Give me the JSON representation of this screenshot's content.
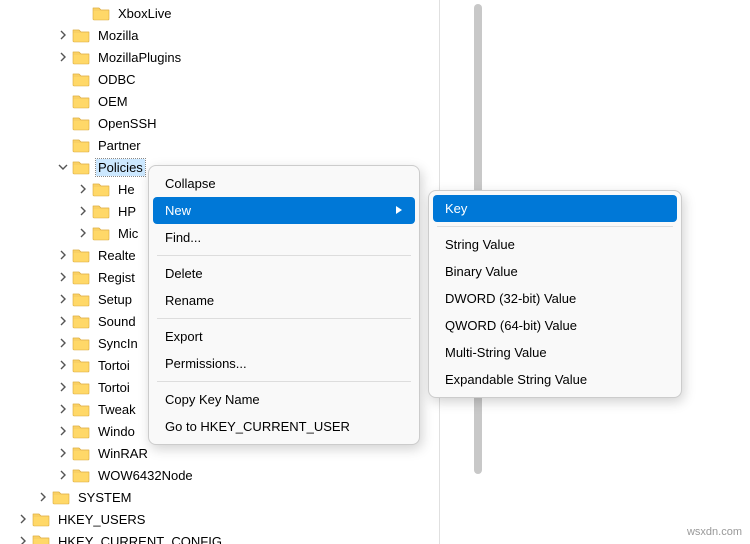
{
  "tree": [
    {
      "indent": 76,
      "chev": "",
      "label": "XboxLive"
    },
    {
      "indent": 56,
      "chev": "right",
      "label": "Mozilla"
    },
    {
      "indent": 56,
      "chev": "right",
      "label": "MozillaPlugins"
    },
    {
      "indent": 56,
      "chev": "",
      "label": "ODBC"
    },
    {
      "indent": 56,
      "chev": "",
      "label": "OEM"
    },
    {
      "indent": 56,
      "chev": "",
      "label": "OpenSSH"
    },
    {
      "indent": 56,
      "chev": "",
      "label": "Partner"
    },
    {
      "indent": 56,
      "chev": "down",
      "label": "Policies",
      "selected": true
    },
    {
      "indent": 76,
      "chev": "right",
      "label": "He"
    },
    {
      "indent": 76,
      "chev": "right",
      "label": "HP"
    },
    {
      "indent": 76,
      "chev": "right",
      "label": "Mic"
    },
    {
      "indent": 56,
      "chev": "right",
      "label": "Realte"
    },
    {
      "indent": 56,
      "chev": "right",
      "label": "Regist"
    },
    {
      "indent": 56,
      "chev": "right",
      "label": "Setup"
    },
    {
      "indent": 56,
      "chev": "right",
      "label": "Sound"
    },
    {
      "indent": 56,
      "chev": "right",
      "label": "SyncIn"
    },
    {
      "indent": 56,
      "chev": "right",
      "label": "Tortoi"
    },
    {
      "indent": 56,
      "chev": "right",
      "label": "Tortoi"
    },
    {
      "indent": 56,
      "chev": "right",
      "label": "Tweak"
    },
    {
      "indent": 56,
      "chev": "right",
      "label": "Windo"
    },
    {
      "indent": 56,
      "chev": "right",
      "label": "WinRAR"
    },
    {
      "indent": 56,
      "chev": "right",
      "label": "WOW6432Node"
    },
    {
      "indent": 36,
      "chev": "right",
      "label": "SYSTEM"
    },
    {
      "indent": 16,
      "chev": "right",
      "label": "HKEY_USERS"
    },
    {
      "indent": 16,
      "chev": "right",
      "label": "HKEY_CURRENT_CONFIG"
    }
  ],
  "menu": {
    "collapse": "Collapse",
    "new": "New",
    "find": "Find...",
    "delete": "Delete",
    "rename": "Rename",
    "export": "Export",
    "permissions": "Permissions...",
    "copyKeyName": "Copy Key Name",
    "goTo": "Go to HKEY_CURRENT_USER"
  },
  "submenu": {
    "key": "Key",
    "string": "String Value",
    "binary": "Binary Value",
    "dword": "DWORD (32-bit) Value",
    "qword": "QWORD (64-bit) Value",
    "multi": "Multi-String Value",
    "expand": "Expandable String Value"
  },
  "watermark": "wsxdn.com"
}
